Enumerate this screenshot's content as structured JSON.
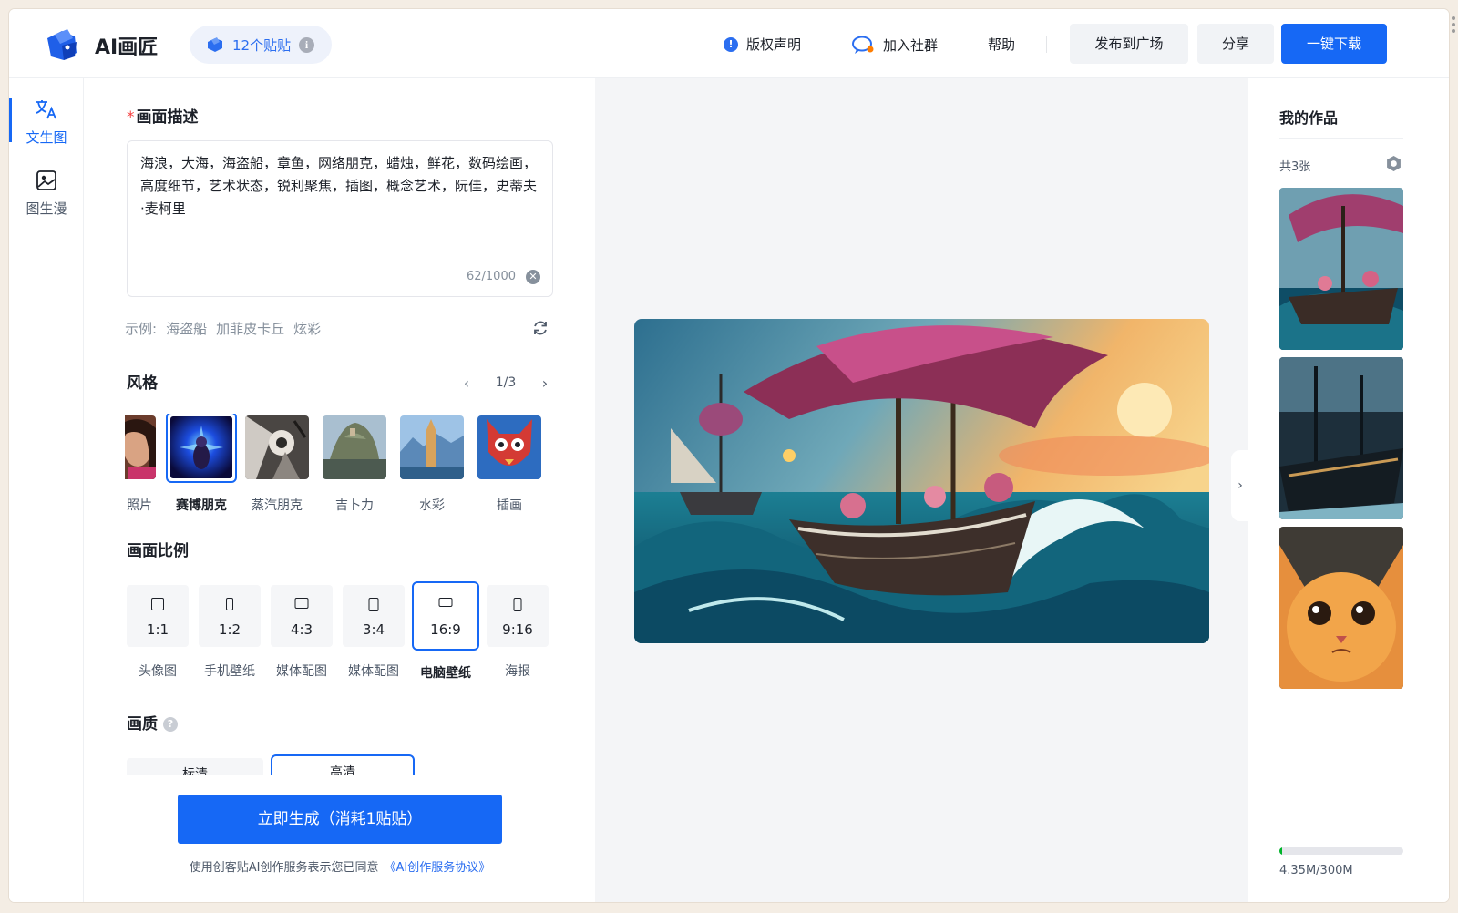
{
  "header": {
    "app_title": "AI画匠",
    "stickers_label": "12个贴贴",
    "links": {
      "copyright": "版权声明",
      "community": "加入社群",
      "help": "帮助"
    },
    "buttons": {
      "publish": "发布到广场",
      "share": "分享",
      "download": "一键下载"
    },
    "accent_color": "#1668f5"
  },
  "leftnav": {
    "items": [
      {
        "label": "文生图",
        "icon": "translate-icon",
        "active": true
      },
      {
        "label": "图生漫",
        "icon": "image-icon",
        "active": false
      }
    ]
  },
  "form": {
    "prompt": {
      "title": "画面描述",
      "required_mark": "*",
      "text": "海浪，大海，海盗船，章鱼，网络朋克，蜡烛，鲜花，数码绘画，高度细节，艺术状态，锐利聚焦，插图，概念艺术，阮佳，史蒂夫·麦柯里",
      "counter": "62/1000"
    },
    "examples": {
      "prefix": "示例:",
      "items": [
        "海盗船",
        "加菲皮卡丘",
        "炫彩"
      ]
    },
    "style": {
      "title": "风格",
      "page": "1/3",
      "items": [
        {
          "label": "照片",
          "active": false
        },
        {
          "label": "赛博朋克",
          "active": true
        },
        {
          "label": "蒸汽朋克",
          "active": false
        },
        {
          "label": "吉卜力",
          "active": false
        },
        {
          "label": "水彩",
          "active": false
        },
        {
          "label": "插画",
          "active": false
        }
      ]
    },
    "ratio": {
      "title": "画面比例",
      "items": [
        {
          "value": "1:1",
          "label": "头像图",
          "active": false
        },
        {
          "value": "1:2",
          "label": "手机壁纸",
          "active": false
        },
        {
          "value": "4:3",
          "label": "媒体配图",
          "active": false
        },
        {
          "value": "3:4",
          "label": "媒体配图",
          "active": false
        },
        {
          "value": "16:9",
          "label": "电脑壁纸",
          "active": true
        },
        {
          "value": "9:16",
          "label": "海报",
          "active": false
        }
      ]
    },
    "quality": {
      "title": "画质",
      "help": "?",
      "options": [
        {
          "label": "标清",
          "active": false
        },
        {
          "label": "高清",
          "active": true
        }
      ]
    },
    "generate_button": "立即生成（消耗1贴贴）",
    "agreement_text": "使用创客贴AI创作服务表示您已同意",
    "agreement_link": "《AI创作服务协议》"
  },
  "preview": {
    "image": "pirate-ship-image",
    "expand": "›"
  },
  "works": {
    "title": "我的作品",
    "count": "共3张",
    "thumbs": [
      "pirate-ship-thumb",
      "dark-ship-thumb",
      "orange-cat-thumb"
    ],
    "storage_text": "4.35M/300M",
    "storage_fraction": 0.0145,
    "storage_color": "#00b42a"
  }
}
